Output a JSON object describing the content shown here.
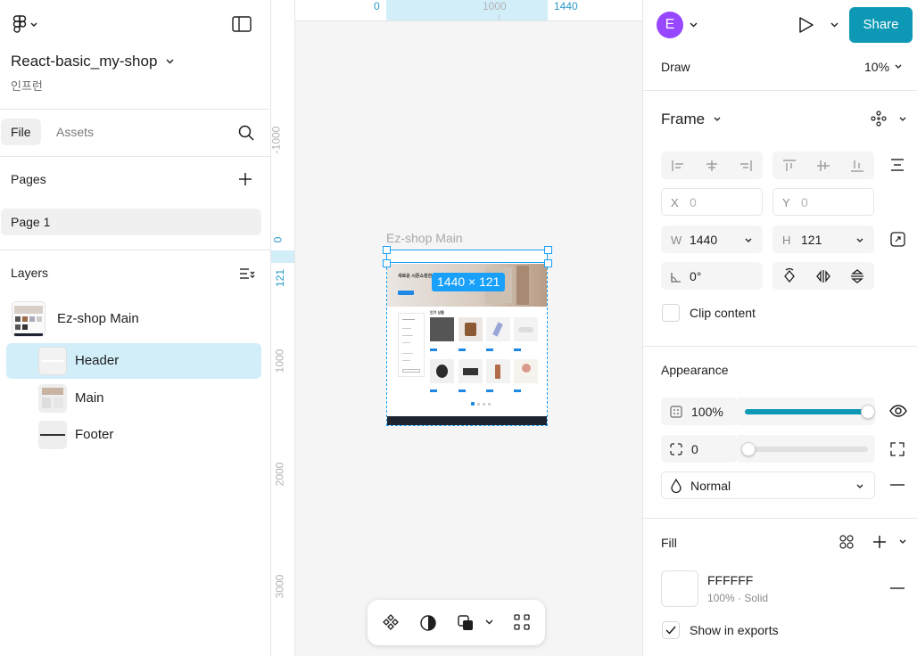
{
  "project": {
    "name": "React-basic_my-shop",
    "team": "인프런"
  },
  "left_tabs": [
    {
      "label": "File"
    },
    {
      "label": "Assets"
    }
  ],
  "pages": {
    "title": "Pages",
    "items": [
      {
        "label": "Page 1"
      }
    ]
  },
  "layers": {
    "title": "Layers",
    "items": [
      {
        "label": "Ez-shop Main"
      },
      {
        "label": "Header"
      },
      {
        "label": "Main"
      },
      {
        "label": "Footer"
      }
    ]
  },
  "canvas": {
    "ruler_top": {
      "t0": "0",
      "t1000": "1000",
      "t1440": "1440"
    },
    "ruler_left": {
      "tm1000": "-1000",
      "t0": "0",
      "t121": "121",
      "t1000": "1000",
      "t2000": "2000",
      "t3000": "3000"
    },
    "frame_label": "Ez-shop Main",
    "size_badge": "1440 × 121",
    "preview": {
      "hero_text": "새로운 시즌쇼핑한 하루",
      "section_title": "인기 상품"
    }
  },
  "right": {
    "avatar_letter": "E",
    "share_label": "Share",
    "draw_label": "Draw",
    "zoom": "10%",
    "frame_title": "Frame",
    "x_label": "X",
    "x_value": "0",
    "y_label": "Y",
    "y_value": "0",
    "w_label": "W",
    "w_value": "1440",
    "h_label": "H",
    "h_value": "121",
    "rotation": "0°",
    "clip_label": "Clip content",
    "appearance_title": "Appearance",
    "opacity": "100%",
    "opacity_level": 1.0,
    "radius": "0",
    "blend_mode": "Normal",
    "fill_title": "Fill",
    "fill_hex": "FFFFFF",
    "fill_sub": "100% · Solid",
    "show_exports": "Show in exports"
  },
  "colors": {
    "accent": "#0d99b5",
    "selection": "#18a0fb",
    "avatar": "#9747ff",
    "fill": "#FFFFFF"
  }
}
